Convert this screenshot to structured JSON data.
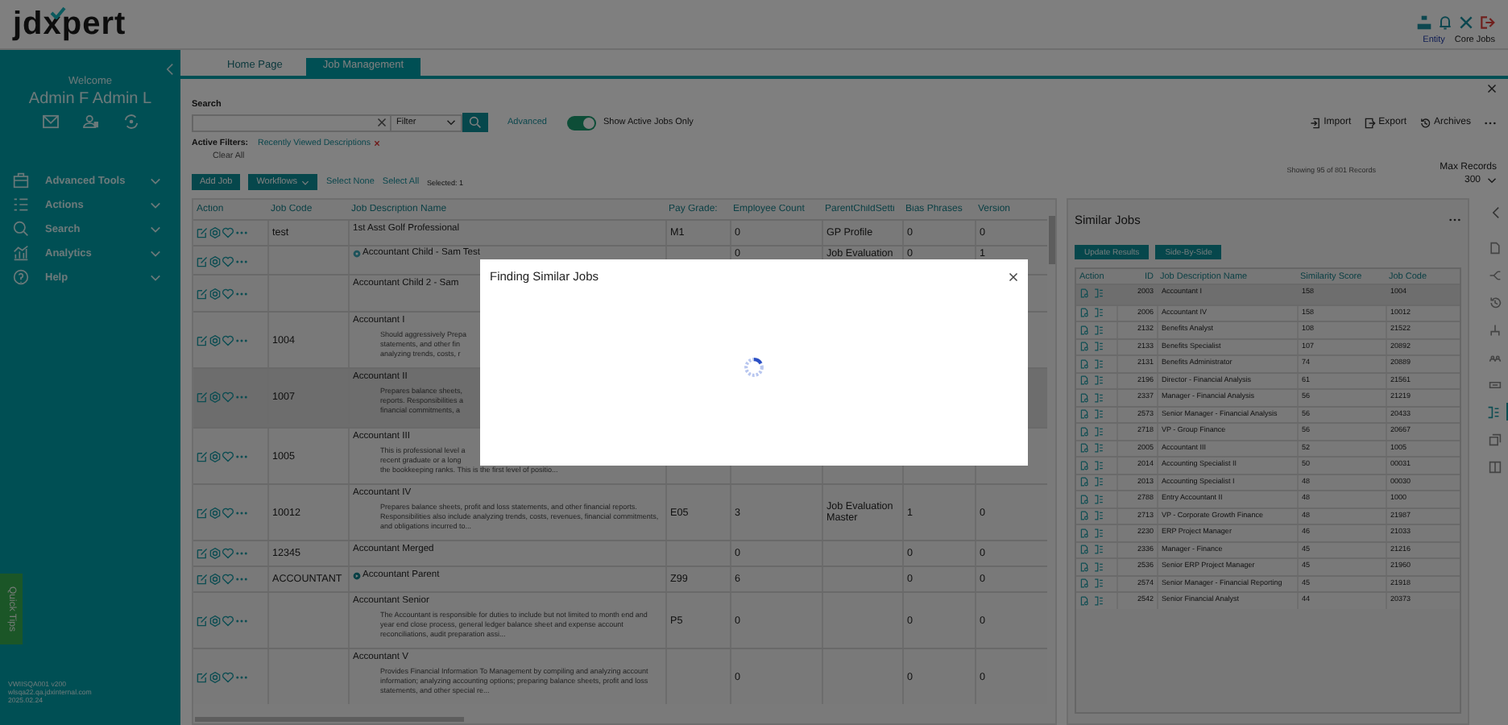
{
  "header": {
    "logo": "jdxpert",
    "links": [
      {
        "label": "Entity",
        "kind": "link"
      },
      {
        "label": "Core Jobs",
        "kind": "plain"
      }
    ]
  },
  "sidebar": {
    "welcome": "Welcome",
    "user": "Admin F Admin L",
    "menu": [
      {
        "label": "Advanced Tools"
      },
      {
        "label": "Actions"
      },
      {
        "label": "Search"
      },
      {
        "label": "Analytics"
      },
      {
        "label": "Help"
      }
    ],
    "quick_tips": "Quick Tips",
    "footer": [
      "VWIISQA001 v200",
      "wlsqa22.qa.jdxinternal.com",
      "2025.02.24"
    ]
  },
  "tabs": [
    {
      "label": "Home Page",
      "selected": false
    },
    {
      "label": "Job Management",
      "selected": true
    }
  ],
  "search": {
    "label": "Search",
    "filter": "Filter",
    "advanced": "Advanced",
    "toggle": {
      "label": "Show Active Jobs Only",
      "on": true
    }
  },
  "actions": [
    {
      "label": "Import"
    },
    {
      "label": "Export"
    },
    {
      "label": "Archives"
    }
  ],
  "active_filters": {
    "label": "Active Filters:",
    "filters": [
      "Recently Viewed Descriptions"
    ],
    "clear": "Clear All"
  },
  "toolbar": {
    "add": "Add Job",
    "workflows": "Workflows",
    "links": [
      "Select None",
      "Select All"
    ],
    "selected": "Selected: 1"
  },
  "records": {
    "showing": "Showing 95 of 801 Records",
    "max_label": "Max Records",
    "max": "300"
  },
  "jobs": {
    "columns": [
      "Action",
      "Job Code",
      "Job Description Name",
      "Pay Grade:",
      "Employee Count",
      "ParentChildSetti",
      "Bias Phrases",
      "Version"
    ],
    "rows": [
      {
        "code": "test",
        "name": "1st Asst Golf Professional",
        "pay_grade": "M1",
        "employee_count": "0",
        "parent_child": "GP Profile",
        "bias": "0",
        "version": "0",
        "selected": false
      },
      {
        "name": "Accountant Child - Sam Test",
        "kind": "child",
        "employee_count": "0",
        "parent_child": "Job Evaluation",
        "bias": "0",
        "version": "1",
        "selected": false
      },
      {
        "name": "Accountant Child 2 - Sam",
        "selected": false
      },
      {
        "code": "1004",
        "name": "Accountant I",
        "desc": "Should aggressively Prepa\nstatements, and other fin\nanalyzing trends, costs, r",
        "selected": false
      },
      {
        "code": "1007",
        "name": "Accountant II",
        "desc": "Prepares balance sheets,\nreports. Responsibilities a\nfinancial commitments, a",
        "selected": true
      },
      {
        "code": "1005",
        "name": "Accountant III",
        "desc": "This is professional level a\nrecent graduate or a long\nthe bookkeeping ranks.  This is the first level of positio...",
        "selected": false
      },
      {
        "code": "10012",
        "name": "Accountant IV",
        "desc": "Prepares balance sheets, profit and loss statements, and other financial reports. Responsibilities also include analyzing trends, costs, revenues, financial commitments, and obligations incurred to...",
        "pay_grade": "E05",
        "employee_count": "3",
        "parent_child": "Job Evaluation Master",
        "bias": "1",
        "version": "0",
        "selected": false
      },
      {
        "code": "12345",
        "name": "Accountant Merged",
        "employee_count": "0",
        "bias": "0",
        "version": "0",
        "selected": false
      },
      {
        "code": "ACCOUNTANT",
        "name": "Accountant Parent",
        "kind": "parent",
        "pay_grade": "Z99",
        "employee_count": "6",
        "bias": "0",
        "version": "0",
        "selected": false
      },
      {
        "name": "Accountant Senior",
        "desc": "The Accountant is responsible for duties to include but not limited to month end and year end close process, general ledger balance sheet and expense account reconciliations, audit preparation assi...",
        "pay_grade": "P5",
        "employee_count": "0",
        "bias": "0",
        "version": "0",
        "selected": false
      },
      {
        "name": "Accountant V",
        "desc": "Provides Financial Information To Management by compiling and analyzing account information; analyzing accounting options; preparing balance sheets, profit and loss statements, and other special re...",
        "employee_count": "0",
        "bias": "0",
        "version": "0",
        "selected": false
      }
    ]
  },
  "similar": {
    "title": "Similar Jobs",
    "buttons": [
      "Update Results",
      "Side-By-Side"
    ],
    "columns": [
      "Action",
      "ID",
      "Job Description Name",
      "Similarity Score",
      "Job Code"
    ],
    "rows": [
      {
        "id": "2003",
        "name": "Accountant I",
        "score": "158",
        "code": "1004",
        "selected": true
      },
      {
        "id": "2006",
        "name": "Accountant IV",
        "score": "158",
        "code": "10012",
        "selected": false
      },
      {
        "id": "2132",
        "name": "Benefits Analyst",
        "score": "108",
        "code": "21522",
        "selected": false
      },
      {
        "id": "2133",
        "name": "Benefits Specialist",
        "score": "107",
        "code": "20892",
        "selected": false
      },
      {
        "id": "2131",
        "name": "Benefits Administrator",
        "score": "74",
        "code": "20889",
        "selected": false
      },
      {
        "id": "2196",
        "name": "Director - Financial Analysis",
        "score": "61",
        "code": "21561",
        "selected": false
      },
      {
        "id": "2337",
        "name": "Manager - Financial Analysis",
        "score": "56",
        "code": "21219",
        "selected": false
      },
      {
        "id": "2573",
        "name": "Senior Manager - Financial Analysis",
        "score": "56",
        "code": "20433",
        "selected": false
      },
      {
        "id": "2718",
        "name": "VP - Group Finance",
        "score": "56",
        "code": "20667",
        "selected": false
      },
      {
        "id": "2005",
        "name": "Accountant III",
        "score": "52",
        "code": "1005",
        "selected": false
      },
      {
        "id": "2014",
        "name": "Accounting Specialist II",
        "score": "50",
        "code": "00031",
        "selected": false
      },
      {
        "id": "2013",
        "name": "Accounting Specialist I",
        "score": "48",
        "code": "00030",
        "selected": false
      },
      {
        "id": "2788",
        "name": "Entry Accountant II",
        "score": "48",
        "code": "1000",
        "selected": false
      },
      {
        "id": "2713",
        "name": "VP - Corporate Growth Finance",
        "score": "48",
        "code": "21987",
        "selected": false
      },
      {
        "id": "2230",
        "name": "ERP Project Manager",
        "score": "46",
        "code": "21033",
        "selected": false
      },
      {
        "id": "2336",
        "name": "Manager - Finance",
        "score": "45",
        "code": "21216",
        "selected": false
      },
      {
        "id": "2536",
        "name": "Senior ERP Project Manager",
        "score": "45",
        "code": "21960",
        "selected": false
      },
      {
        "id": "2574",
        "name": "Senior Manager - Financial Reporting",
        "score": "45",
        "code": "21918",
        "selected": false
      },
      {
        "id": "2542",
        "name": "Senior Financial Analyst",
        "score": "44",
        "code": "20373",
        "selected": false
      }
    ]
  },
  "rail": [
    {
      "selected": false
    },
    {
      "selected": false
    },
    {
      "selected": false
    },
    {
      "selected": false
    },
    {
      "selected": false
    },
    {
      "selected": false
    },
    {
      "selected": true
    },
    {
      "selected": false
    },
    {
      "selected": false
    }
  ],
  "modal": {
    "title": "Finding Similar Jobs",
    "loading": true
  }
}
